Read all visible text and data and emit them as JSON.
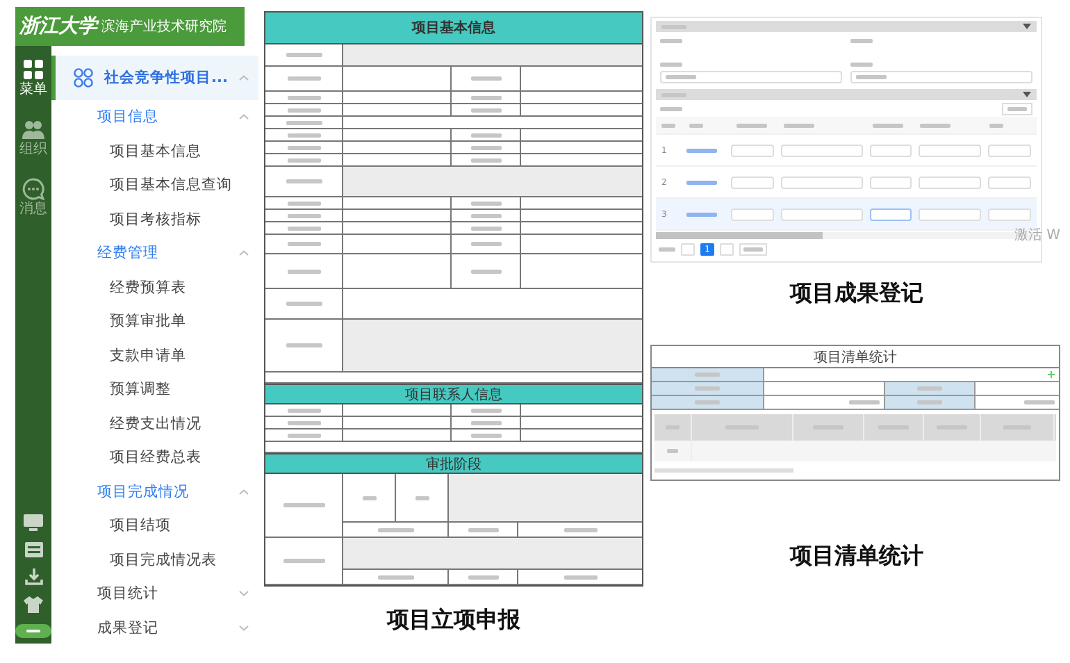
{
  "header": {
    "logo": "浙江大学",
    "title": "滨海产业技术研究院"
  },
  "rail": {
    "items": [
      {
        "kind": "grid",
        "label": "菜单",
        "selected": true
      },
      {
        "kind": "people",
        "label": "组织",
        "selected": false
      },
      {
        "kind": "chat",
        "label": "消息",
        "selected": false
      }
    ],
    "tools": [
      {
        "kind": "monitor"
      },
      {
        "kind": "list"
      },
      {
        "kind": "download"
      },
      {
        "kind": "shirt"
      },
      {
        "kind": "toggle",
        "on": true
      }
    ]
  },
  "menu": {
    "items": [
      {
        "label": "社会竞争性项目...",
        "expanded": true,
        "selected": true,
        "children": [
          {
            "label": "项目信息",
            "expanded": true,
            "children": [
              {
                "label": "项目基本信息"
              },
              {
                "label": "项目基本信息查询"
              },
              {
                "label": "项目考核指标"
              }
            ]
          },
          {
            "label": "经费管理",
            "expanded": true,
            "children": [
              {
                "label": "经费预算表"
              },
              {
                "label": "预算审批单"
              },
              {
                "label": "支款申请单"
              },
              {
                "label": "预算调整"
              },
              {
                "label": "经费支出情况"
              },
              {
                "label": "项目经费总表"
              }
            ]
          },
          {
            "label": "项目完成情况",
            "expanded": true,
            "children": [
              {
                "label": "项目结项"
              },
              {
                "label": "项目完成情况表"
              }
            ]
          },
          {
            "label": "项目统计",
            "expanded": false
          },
          {
            "label": "成果登记",
            "expanded": false
          }
        ]
      }
    ]
  },
  "application": {
    "title": "项目基本信息",
    "sections": [
      "项目联系人信息",
      "审批阶段"
    ],
    "caption": "项目立项申报"
  },
  "results": {
    "rows": [
      {
        "number": "1",
        "selected": false
      },
      {
        "number": "2",
        "selected": false
      },
      {
        "number": "3",
        "selected": true
      }
    ],
    "page": "1",
    "overlay_text": "激活 W",
    "caption": "项目成果登记"
  },
  "statistics": {
    "title": "项目清单统计",
    "caption": "项目清单统计"
  }
}
